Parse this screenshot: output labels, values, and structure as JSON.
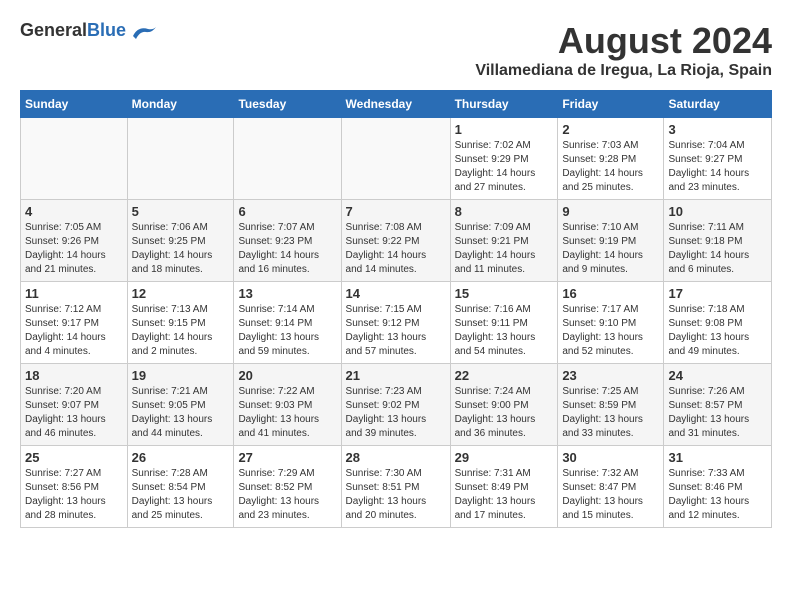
{
  "header": {
    "logo_general": "General",
    "logo_blue": "Blue",
    "month_title": "August 2024",
    "location": "Villamediana de Iregua, La Rioja, Spain"
  },
  "weekdays": [
    "Sunday",
    "Monday",
    "Tuesday",
    "Wednesday",
    "Thursday",
    "Friday",
    "Saturday"
  ],
  "weeks": [
    [
      {
        "day": "",
        "info": ""
      },
      {
        "day": "",
        "info": ""
      },
      {
        "day": "",
        "info": ""
      },
      {
        "day": "",
        "info": ""
      },
      {
        "day": "1",
        "info": "Sunrise: 7:02 AM\nSunset: 9:29 PM\nDaylight: 14 hours\nand 27 minutes."
      },
      {
        "day": "2",
        "info": "Sunrise: 7:03 AM\nSunset: 9:28 PM\nDaylight: 14 hours\nand 25 minutes."
      },
      {
        "day": "3",
        "info": "Sunrise: 7:04 AM\nSunset: 9:27 PM\nDaylight: 14 hours\nand 23 minutes."
      }
    ],
    [
      {
        "day": "4",
        "info": "Sunrise: 7:05 AM\nSunset: 9:26 PM\nDaylight: 14 hours\nand 21 minutes."
      },
      {
        "day": "5",
        "info": "Sunrise: 7:06 AM\nSunset: 9:25 PM\nDaylight: 14 hours\nand 18 minutes."
      },
      {
        "day": "6",
        "info": "Sunrise: 7:07 AM\nSunset: 9:23 PM\nDaylight: 14 hours\nand 16 minutes."
      },
      {
        "day": "7",
        "info": "Sunrise: 7:08 AM\nSunset: 9:22 PM\nDaylight: 14 hours\nand 14 minutes."
      },
      {
        "day": "8",
        "info": "Sunrise: 7:09 AM\nSunset: 9:21 PM\nDaylight: 14 hours\nand 11 minutes."
      },
      {
        "day": "9",
        "info": "Sunrise: 7:10 AM\nSunset: 9:19 PM\nDaylight: 14 hours\nand 9 minutes."
      },
      {
        "day": "10",
        "info": "Sunrise: 7:11 AM\nSunset: 9:18 PM\nDaylight: 14 hours\nand 6 minutes."
      }
    ],
    [
      {
        "day": "11",
        "info": "Sunrise: 7:12 AM\nSunset: 9:17 PM\nDaylight: 14 hours\nand 4 minutes."
      },
      {
        "day": "12",
        "info": "Sunrise: 7:13 AM\nSunset: 9:15 PM\nDaylight: 14 hours\nand 2 minutes."
      },
      {
        "day": "13",
        "info": "Sunrise: 7:14 AM\nSunset: 9:14 PM\nDaylight: 13 hours\nand 59 minutes."
      },
      {
        "day": "14",
        "info": "Sunrise: 7:15 AM\nSunset: 9:12 PM\nDaylight: 13 hours\nand 57 minutes."
      },
      {
        "day": "15",
        "info": "Sunrise: 7:16 AM\nSunset: 9:11 PM\nDaylight: 13 hours\nand 54 minutes."
      },
      {
        "day": "16",
        "info": "Sunrise: 7:17 AM\nSunset: 9:10 PM\nDaylight: 13 hours\nand 52 minutes."
      },
      {
        "day": "17",
        "info": "Sunrise: 7:18 AM\nSunset: 9:08 PM\nDaylight: 13 hours\nand 49 minutes."
      }
    ],
    [
      {
        "day": "18",
        "info": "Sunrise: 7:20 AM\nSunset: 9:07 PM\nDaylight: 13 hours\nand 46 minutes."
      },
      {
        "day": "19",
        "info": "Sunrise: 7:21 AM\nSunset: 9:05 PM\nDaylight: 13 hours\nand 44 minutes."
      },
      {
        "day": "20",
        "info": "Sunrise: 7:22 AM\nSunset: 9:03 PM\nDaylight: 13 hours\nand 41 minutes."
      },
      {
        "day": "21",
        "info": "Sunrise: 7:23 AM\nSunset: 9:02 PM\nDaylight: 13 hours\nand 39 minutes."
      },
      {
        "day": "22",
        "info": "Sunrise: 7:24 AM\nSunset: 9:00 PM\nDaylight: 13 hours\nand 36 minutes."
      },
      {
        "day": "23",
        "info": "Sunrise: 7:25 AM\nSunset: 8:59 PM\nDaylight: 13 hours\nand 33 minutes."
      },
      {
        "day": "24",
        "info": "Sunrise: 7:26 AM\nSunset: 8:57 PM\nDaylight: 13 hours\nand 31 minutes."
      }
    ],
    [
      {
        "day": "25",
        "info": "Sunrise: 7:27 AM\nSunset: 8:56 PM\nDaylight: 13 hours\nand 28 minutes."
      },
      {
        "day": "26",
        "info": "Sunrise: 7:28 AM\nSunset: 8:54 PM\nDaylight: 13 hours\nand 25 minutes."
      },
      {
        "day": "27",
        "info": "Sunrise: 7:29 AM\nSunset: 8:52 PM\nDaylight: 13 hours\nand 23 minutes."
      },
      {
        "day": "28",
        "info": "Sunrise: 7:30 AM\nSunset: 8:51 PM\nDaylight: 13 hours\nand 20 minutes."
      },
      {
        "day": "29",
        "info": "Sunrise: 7:31 AM\nSunset: 8:49 PM\nDaylight: 13 hours\nand 17 minutes."
      },
      {
        "day": "30",
        "info": "Sunrise: 7:32 AM\nSunset: 8:47 PM\nDaylight: 13 hours\nand 15 minutes."
      },
      {
        "day": "31",
        "info": "Sunrise: 7:33 AM\nSunset: 8:46 PM\nDaylight: 13 hours\nand 12 minutes."
      }
    ]
  ]
}
